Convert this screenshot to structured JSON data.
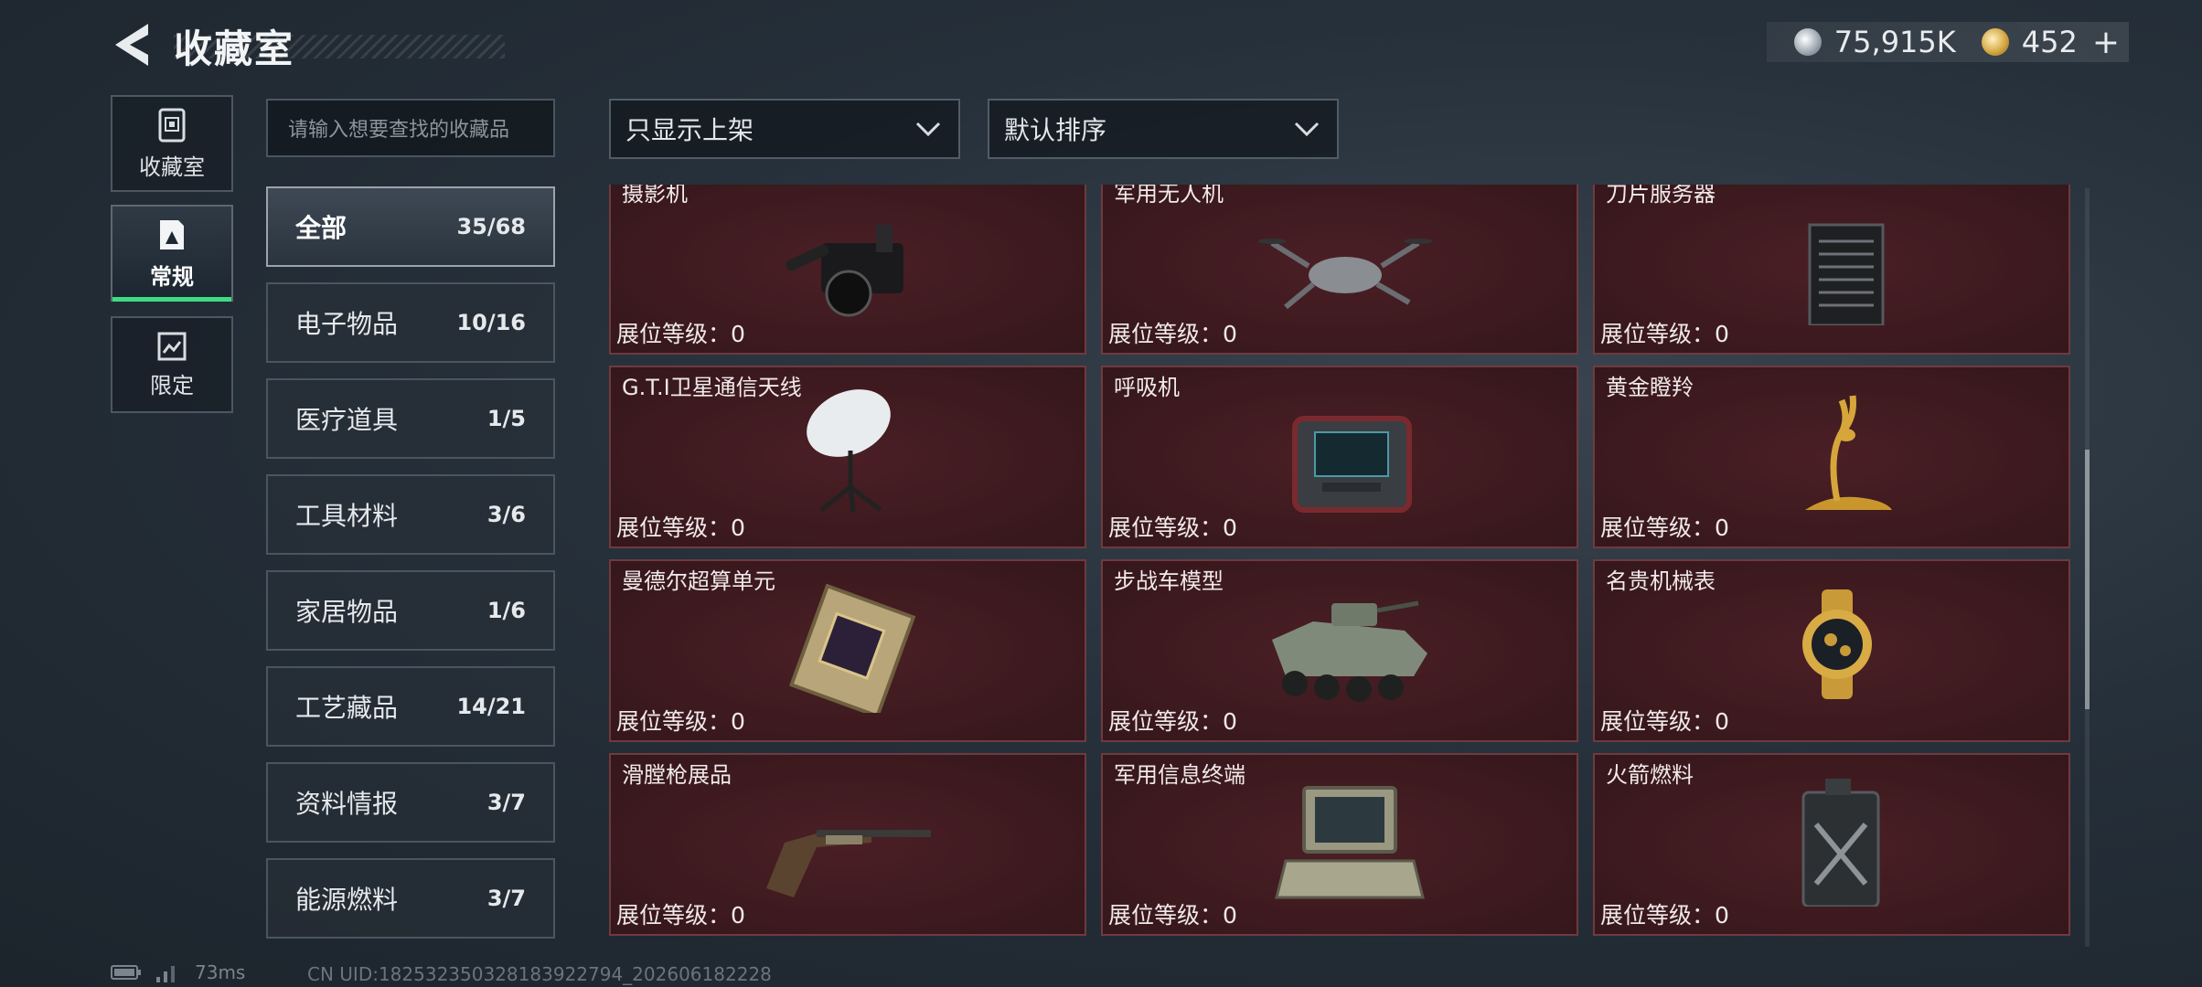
{
  "header": {
    "title": "收藏室",
    "currency_silver": "75,915K",
    "currency_gold": "452",
    "plus": "+"
  },
  "left_nav": [
    {
      "label": "收藏室",
      "icon": "collection-room-icon"
    },
    {
      "label": "常规",
      "icon": "regular-icon",
      "active": true
    },
    {
      "label": "限定",
      "icon": "limited-icon"
    }
  ],
  "search": {
    "placeholder": "请输入想要查找的收藏品"
  },
  "filters": {
    "display": "只显示上架",
    "sort": "默认排序"
  },
  "categories": [
    {
      "name": "全部",
      "count": "35/68",
      "active": true
    },
    {
      "name": "电子物品",
      "count": "10/16"
    },
    {
      "name": "医疗道具",
      "count": "1/5"
    },
    {
      "name": "工具材料",
      "count": "3/6"
    },
    {
      "name": "家居物品",
      "count": "1/6"
    },
    {
      "name": "工艺藏品",
      "count": "14/21"
    },
    {
      "name": "资料情报",
      "count": "3/7"
    },
    {
      "name": "能源燃料",
      "count": "3/7"
    }
  ],
  "items": [
    {
      "name": "摄影机",
      "level": "展位等级：0",
      "icon": "camera-icon"
    },
    {
      "name": "军用无人机",
      "level": "展位等级：0",
      "icon": "drone-icon"
    },
    {
      "name": "刀片服务器",
      "level": "展位等级：0",
      "icon": "server-icon"
    },
    {
      "name": "G.T.I卫星通信天线",
      "level": "展位等级：0",
      "icon": "satellite-dish-icon"
    },
    {
      "name": "呼吸机",
      "level": "展位等级：0",
      "icon": "ventilator-icon"
    },
    {
      "name": "黄金瞪羚",
      "level": "展位等级：0",
      "icon": "golden-gazelle-icon"
    },
    {
      "name": "曼德尔超算单元",
      "level": "展位等级：0",
      "icon": "computing-unit-icon"
    },
    {
      "name": "步战车模型",
      "level": "展位等级：0",
      "icon": "ifv-model-icon"
    },
    {
      "name": "名贵机械表",
      "level": "展位等级：0",
      "icon": "watch-icon"
    },
    {
      "name": "滑膛枪展品",
      "level": "展位等级：0",
      "icon": "musket-icon"
    },
    {
      "name": "军用信息终端",
      "level": "展位等级：0",
      "icon": "terminal-icon"
    },
    {
      "name": "火箭燃料",
      "level": "展位等级：0",
      "icon": "fuel-can-icon"
    }
  ],
  "status": {
    "ping": "73ms",
    "uid": "CN UID:182532350328183922794_202606182228"
  }
}
